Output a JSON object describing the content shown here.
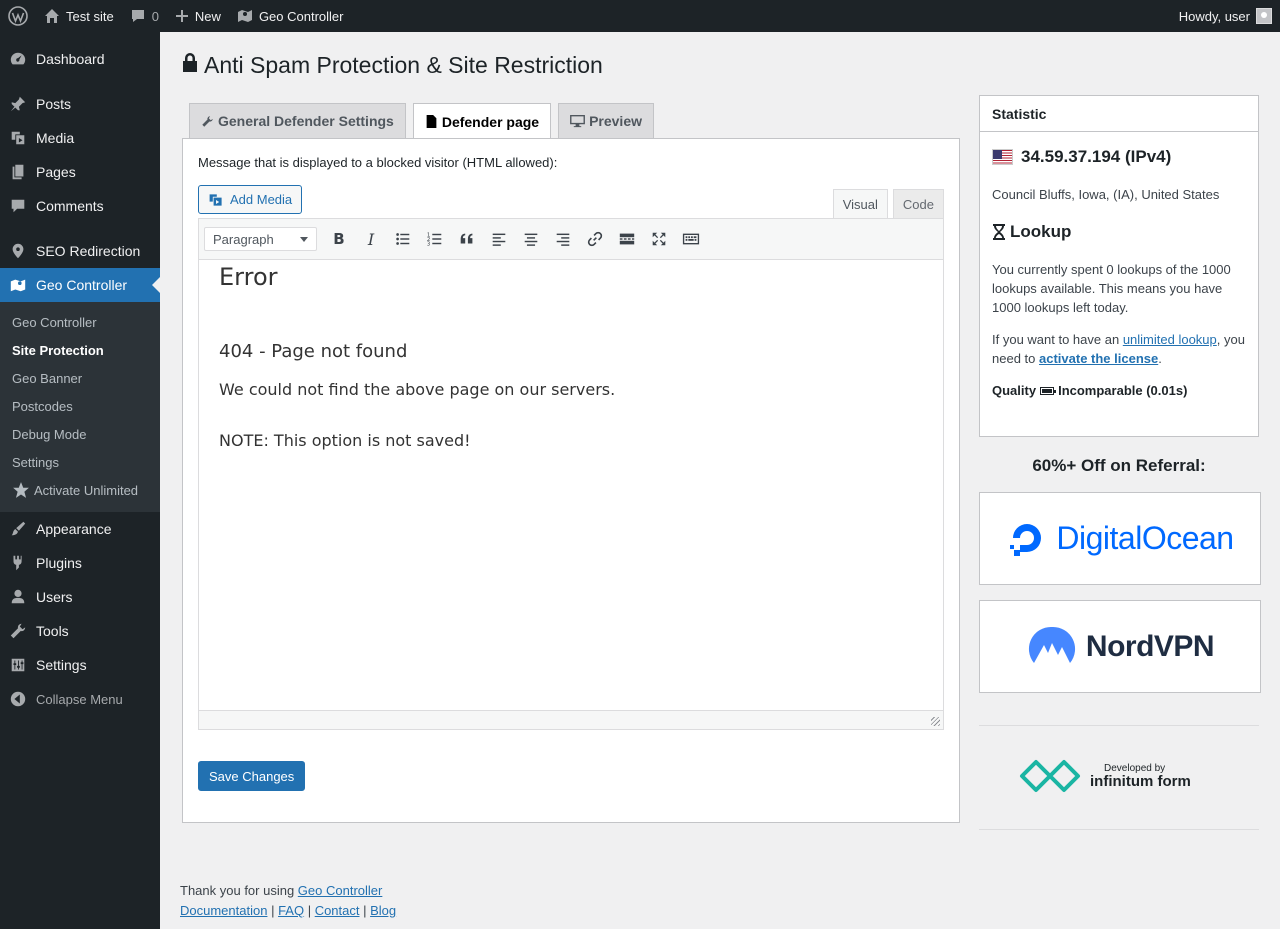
{
  "admin_bar": {
    "site_name": "Test site",
    "comments_count": "0",
    "new_label": "New",
    "plugin_label": "Geo Controller",
    "greeting": "Howdy, user"
  },
  "sidebar": {
    "items": [
      {
        "label": "Dashboard",
        "icon": "dashboard-icon"
      },
      {
        "label": "Posts",
        "icon": "pin-icon"
      },
      {
        "label": "Media",
        "icon": "media-icon"
      },
      {
        "label": "Pages",
        "icon": "pages-icon"
      },
      {
        "label": "Comments",
        "icon": "comment-icon"
      },
      {
        "label": "SEO Redirection",
        "icon": "location-icon"
      },
      {
        "label": "Geo Controller",
        "icon": "map-icon"
      },
      {
        "label": "Appearance",
        "icon": "brush-icon"
      },
      {
        "label": "Plugins",
        "icon": "plugin-icon"
      },
      {
        "label": "Users",
        "icon": "user-icon"
      },
      {
        "label": "Tools",
        "icon": "wrench-icon"
      },
      {
        "label": "Settings",
        "icon": "settings-icon"
      }
    ],
    "submenu": [
      {
        "label": "Geo Controller"
      },
      {
        "label": "Site Protection"
      },
      {
        "label": "Geo Banner"
      },
      {
        "label": "Postcodes"
      },
      {
        "label": "Debug Mode"
      },
      {
        "label": "Settings"
      },
      {
        "label": "Activate Unlimited"
      }
    ],
    "collapse_label": "Collapse Menu"
  },
  "page": {
    "title": "Anti Spam Protection & Site Restriction",
    "tabs": [
      {
        "label": "General Defender Settings",
        "icon": "wrench-icon"
      },
      {
        "label": "Defender page",
        "icon": "file-icon"
      },
      {
        "label": "Preview",
        "icon": "desktop-icon"
      }
    ],
    "description": "Message that is displayed to a blocked visitor (HTML allowed):",
    "add_media_label": "Add Media",
    "mode_tabs": {
      "visual": "Visual",
      "code": "Code"
    },
    "format_select": "Paragraph",
    "editor_content": {
      "heading": "Error",
      "subheading": "404 - Page not found",
      "paragraph": "We could not find the above page on our servers.",
      "note": "NOTE: This option is not saved!"
    },
    "save_label": "Save Changes"
  },
  "statistic": {
    "header": "Statistic",
    "ip": "34.59.37.194 (IPv4)",
    "location": "Council Bluffs, Iowa, (IA), United States",
    "lookup_title": "Lookup",
    "lookup_desc": "You currently spent 0 lookups of the 1000 lookups available. This means you have 1000 lookups left today.",
    "unlimited_prefix": "If you want to have an ",
    "unlimited_link": "unlimited lookup",
    "unlimited_middle": ", you need to ",
    "license_link": "activate the license",
    "unlimited_suffix": ".",
    "quality_label": "Quality",
    "quality_value": "Incomparable (0.01s)"
  },
  "referral": {
    "title": "60%+ Off on Referral:",
    "ads": [
      "DigitalOcean",
      "NordVPN"
    ],
    "developer_small": "Developed by",
    "developer_big": "infinitum form"
  },
  "footer": {
    "thanks_prefix": "Thank you for using ",
    "plugin_link": "Geo Controller",
    "links": [
      "Documentation",
      "FAQ",
      "Contact",
      "Blog"
    ]
  },
  "colors": {
    "admin_dark": "#1d2327",
    "accent_blue": "#2271b1",
    "digitalocean_blue": "#0069ff",
    "nordvpn_blue": "#4687ff",
    "infinitum_teal": "#1ab5a3"
  }
}
